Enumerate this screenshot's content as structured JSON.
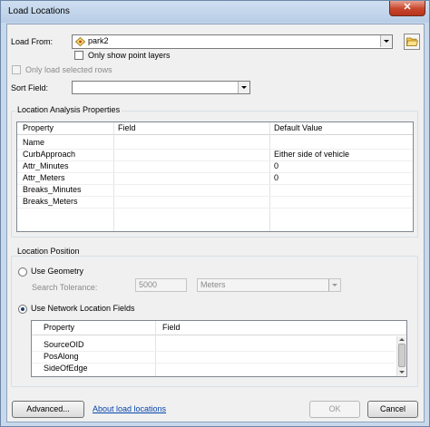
{
  "window": {
    "title": "Load Locations",
    "close_label": "✕"
  },
  "load_from": {
    "label": "Load From:",
    "value": "park2",
    "only_point_layers_label": "Only show point layers",
    "only_selected_rows_label": "Only load selected rows"
  },
  "sort_field": {
    "label": "Sort Field:",
    "value": ""
  },
  "location_analysis": {
    "title": "Location Analysis Properties",
    "columns": [
      "Property",
      "Field",
      "Default Value"
    ],
    "rows": [
      {
        "property": "Name",
        "field": "",
        "default": ""
      },
      {
        "property": "CurbApproach",
        "field": "",
        "default": "Either side of vehicle"
      },
      {
        "property": "Attr_Minutes",
        "field": "",
        "default": "0"
      },
      {
        "property": "Attr_Meters",
        "field": "",
        "default": "0"
      },
      {
        "property": "Breaks_Minutes",
        "field": "",
        "default": ""
      },
      {
        "property": "Breaks_Meters",
        "field": "",
        "default": ""
      }
    ]
  },
  "location_position": {
    "title": "Location Position",
    "use_geometry_label": "Use Geometry",
    "search_tolerance_label": "Search Tolerance:",
    "search_tolerance_value": "5000",
    "units_value": "Meters",
    "use_network_label": "Use Network Location Fields",
    "network_columns": [
      "Property",
      "Field"
    ],
    "network_rows": [
      {
        "property": "SourceOID",
        "field": ""
      },
      {
        "property": "PosAlong",
        "field": ""
      },
      {
        "property": "SideOfEdge",
        "field": ""
      }
    ]
  },
  "footer": {
    "advanced_label": "Advanced...",
    "about_link": "About load locations",
    "ok_label": "OK",
    "cancel_label": "Cancel"
  }
}
